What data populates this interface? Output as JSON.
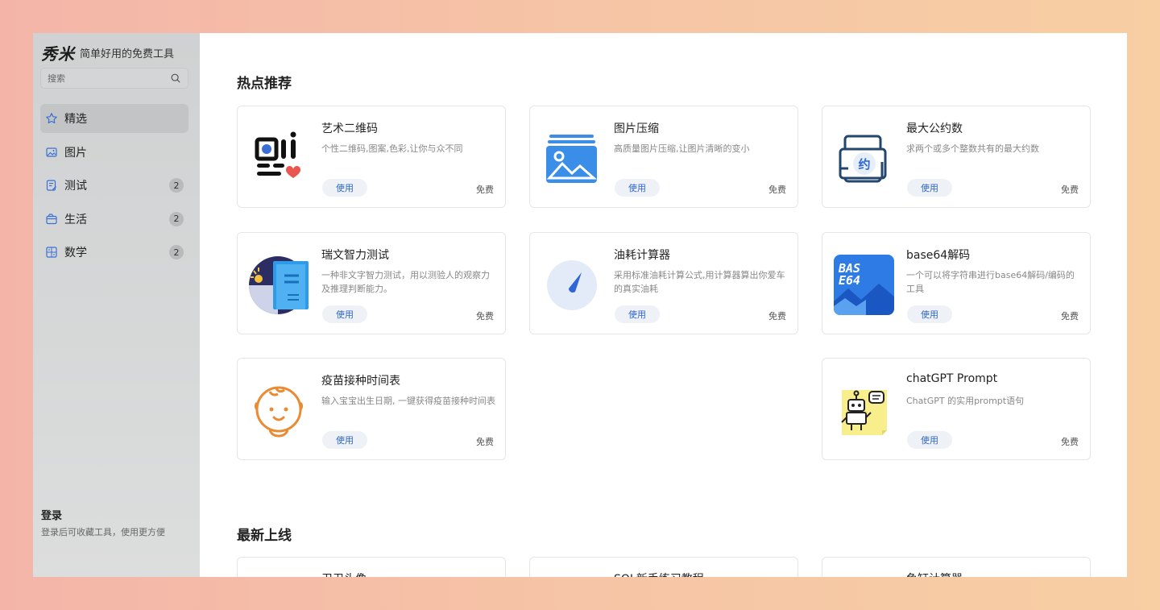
{
  "brand": {
    "logo": "秀米",
    "slogan": "简单好用的免费工具"
  },
  "search": {
    "placeholder": "搜索"
  },
  "nav": {
    "items": [
      {
        "label": "精选",
        "icon": "star-icon",
        "badge": ""
      },
      {
        "label": "图片",
        "icon": "image-icon",
        "badge": ""
      },
      {
        "label": "测试",
        "icon": "test-icon",
        "badge": "2"
      },
      {
        "label": "生活",
        "icon": "life-icon",
        "badge": "2"
      },
      {
        "label": "数学",
        "icon": "math-icon",
        "badge": "2"
      }
    ]
  },
  "login": {
    "title": "登录",
    "subtitle": "登录后可收藏工具，使用更方便"
  },
  "sections": {
    "hot": {
      "title": "热点推荐",
      "cards": [
        {
          "title": "艺术二维码",
          "desc": "个性二维码,图案,色彩,让你与众不同",
          "button": "使用",
          "price": "免费",
          "icon": "qrcode-icon"
        },
        {
          "title": "图片压缩",
          "desc": "高质量图片压缩,让图片清晰的变小",
          "button": "使用",
          "price": "免费",
          "icon": "picture-compress-icon"
        },
        {
          "title": "最大公约数",
          "desc": "求两个或多个整数共有的最大约数",
          "button": "使用",
          "price": "免费",
          "icon": "gcd-icon"
        },
        {
          "title": "瑞文智力测试",
          "desc": "一种非文字智力测试，用以测验人的观察力及推理判断能力。",
          "button": "使用",
          "price": "免费",
          "icon": "book-bulb-icon"
        },
        {
          "title": "油耗计算器",
          "desc": "采用标准油耗计算公式,用计算器算出你爱车的真实油耗",
          "button": "使用",
          "price": "免费",
          "icon": "fuel-gauge-icon"
        },
        {
          "title": "base64解码",
          "desc": "一个可以将字符串进行base64解码/编码的工具",
          "button": "使用",
          "price": "免费",
          "icon": "base64-icon",
          "icon_text": "BAS E64"
        },
        {
          "title": "疫苗接种时间表",
          "desc": "输入宝宝出生日期, 一键获得疫苗接种时间表",
          "button": "使用",
          "price": "免费",
          "icon": "baby-face-icon"
        },
        {
          "title": "chatGPT Prompt",
          "desc": "ChatGPT 的实用prompt语句",
          "button": "使用",
          "price": "免费",
          "icon": "robot-icon"
        }
      ]
    },
    "latest": {
      "title": "最新上线",
      "cards": [
        {
          "title": "卫卫头像"
        },
        {
          "title": "SQL新手练习教程"
        },
        {
          "title": "鱼缸计算器"
        }
      ]
    }
  },
  "colors": {
    "accent": "#2e66d6",
    "sidebar_bg": "#d3d4d5",
    "button_bg": "#eef1f6"
  }
}
